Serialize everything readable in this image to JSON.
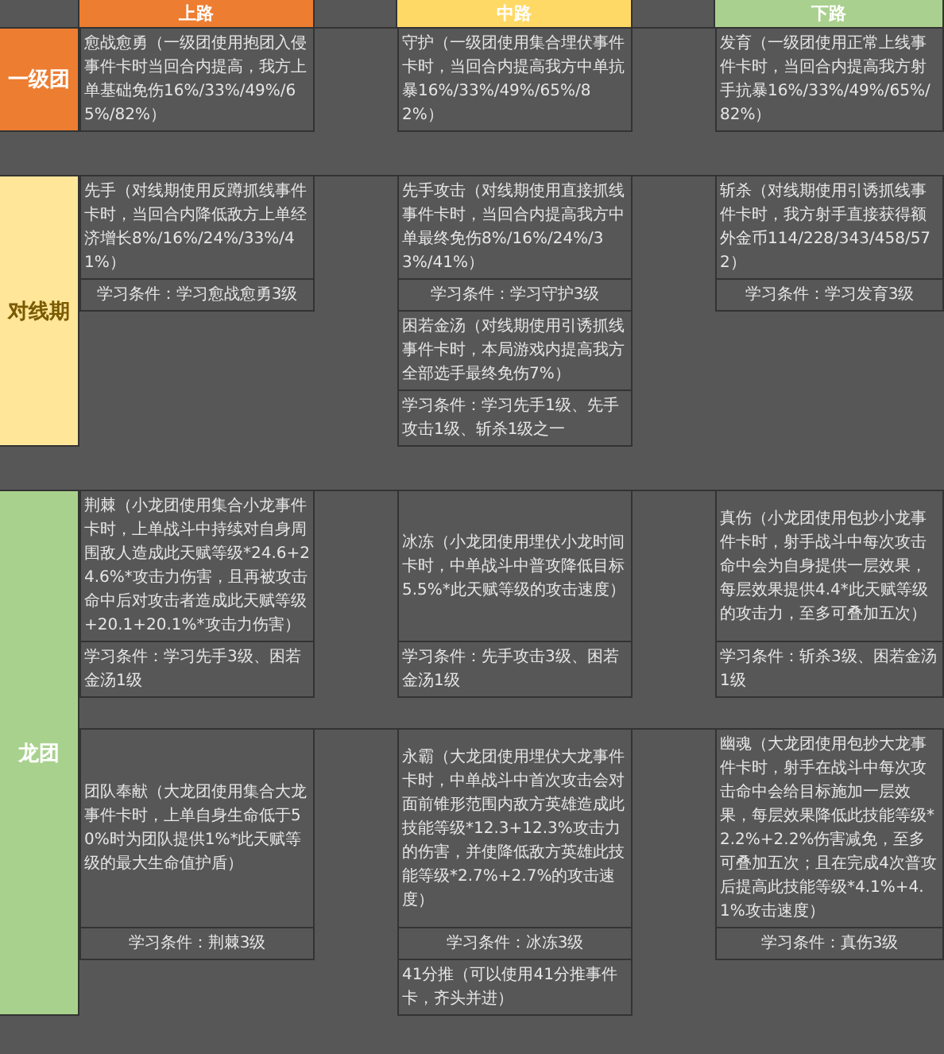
{
  "header": [
    {
      "label": "上路",
      "color": "#ed7d31"
    },
    {
      "label": "中路",
      "color": "#ffd966"
    },
    {
      "label": "下路",
      "color": "#a9d08e"
    }
  ],
  "sections": [
    {
      "label": "一级团",
      "color": "#ed7d31",
      "groups": [
        [
          {
            "left": {
              "kind": "skill",
              "text": "愈战愈勇（一级团使用抱团入侵事件卡时当回合内提高，我方上单基础免伤16%/33%/49%/65%/82%）"
            },
            "middle": {
              "kind": "skill",
              "text": "守护（一级团使用集合埋伏事件卡时，当回合内提高我方中单抗暴16%/33%/49%/65%/82%）"
            },
            "right": {
              "kind": "skill",
              "text": "发育（一级团使用正常上线事件卡时，当回合内提高我方射手抗暴16%/33%/49%/65%/82%）"
            }
          }
        ]
      ]
    },
    {
      "label": "对线期",
      "color": "#ffe699",
      "groups": [
        [
          {
            "left": {
              "kind": "skill",
              "text": "先手（对线期使用反蹲抓线事件卡时，当回合内降低敌方上单经济增长8%/16%/24%/33%/41%）"
            },
            "middle": {
              "kind": "skill",
              "text": "先手攻击（对线期使用直接抓线事件卡时，当回合内提高我方中单最终免伤8%/16%/24%/33%/41%）"
            },
            "right": {
              "kind": "skill",
              "text": "斩杀（对线期使用引诱抓线事件卡时，我方射手直接获得额外金币114/228/343/458/572）"
            }
          },
          {
            "left": {
              "kind": "condition",
              "text": "学习条件：学习愈战愈勇3级"
            },
            "middle": {
              "kind": "condition",
              "text": "学习条件：学习守护3级"
            },
            "right": {
              "kind": "condition",
              "text": "学习条件：学习发育3级"
            }
          },
          {
            "middle": {
              "kind": "skill",
              "text": "困若金汤（对线期使用引诱抓线事件卡时，本局游戏内提高我方全部选手最终免伤7%）"
            }
          },
          {
            "middle": {
              "kind": "condition",
              "text": "学习条件：学习先手1级、先手攻击1级、斩杀1级之一"
            }
          }
        ]
      ]
    },
    {
      "label": "龙团",
      "color": "#a9d18e",
      "groups": [
        [
          {
            "left": {
              "kind": "skill",
              "text": "荆棘（小龙团使用集合小龙事件卡时，上单战斗中持续对自身周围敌人造成此天赋等级*24.6+24.6%*攻击力伤害，且再被攻击命中后对攻击者造成此天赋等级+20.1+20.1%*攻击力伤害）"
            },
            "middle": {
              "kind": "skill",
              "text": "冰冻（小龙团使用埋伏小龙时间卡时，中单战斗中普攻降低目标5.5%*此天赋等级的攻击速度）"
            },
            "right": {
              "kind": "skill",
              "text": "真伤（小龙团使用包抄小龙事件卡时，射手战斗中每次攻击命中会为自身提供一层效果，每层效果提供4.4*此天赋等级的攻击力，至多可叠加五次）"
            }
          },
          {
            "left": {
              "kind": "condition",
              "text": "学习条件：学习先手3级、困若金汤1级"
            },
            "middle": {
              "kind": "condition",
              "text": "学习条件：先手攻击3级、困若金汤1级"
            },
            "right": {
              "kind": "condition",
              "text": "学习条件：斩杀3级、困若金汤1级"
            }
          }
        ],
        [
          {
            "left": {
              "kind": "skill",
              "text": "团队奉献（大龙团使用集合大龙事件卡时，上单自身生命低于50%时为团队提供1%*此天赋等级的最大生命值护盾）"
            },
            "middle": {
              "kind": "skill",
              "text": "永霸（大龙团使用埋伏大龙事件卡时，中单战斗中首次攻击会对面前锥形范围内敌方英雄造成此技能等级*12.3+12.3%攻击力的伤害，并使降低敌方英雄此技能等级*2.7%+2.7%的攻击速度）"
            },
            "right": {
              "kind": "skill",
              "text": "幽魂（大龙团使用包抄大龙事件卡时，射手在战斗中每次攻击命中会给目标施加一层效果，每层效果降低此技能等级*2.2%+2.2%伤害减免，至多可叠加五次；且在完成4次普攻后提高此技能等级*4.1%+4.1%攻击速度）"
            }
          },
          {
            "left": {
              "kind": "condition",
              "text": "学习条件：荆棘3级"
            },
            "middle": {
              "kind": "condition",
              "text": "学习条件：冰冻3级"
            },
            "right": {
              "kind": "condition",
              "text": "学习条件：真伤3级"
            }
          },
          {
            "middle": {
              "kind": "skill",
              "text": "41分推（可以使用41分推事件卡，齐头并进）"
            }
          }
        ]
      ]
    }
  ]
}
